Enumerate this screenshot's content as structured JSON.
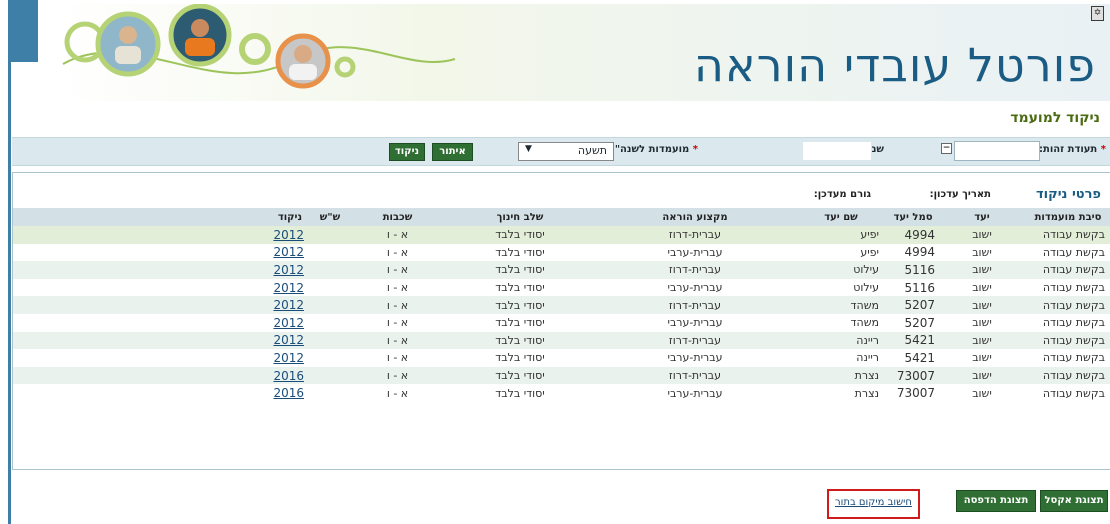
{
  "header": {
    "title": "פורטל עובדי הוראה",
    "corner_icon": "emblem-icon"
  },
  "page_subtitle": "ניקוד למועמד",
  "search": {
    "id_label": "תעודת זהות:",
    "required_mark": "*",
    "name_label": "שם:",
    "year_label": "מועמדות לשנה\"ל:",
    "year_value": "תשעה",
    "locate_button": "איתור",
    "score_button": "ניקוד"
  },
  "details": {
    "title": "פרטי ניקוד",
    "updated_label": "תאריך עדכון:",
    "updated_by_label": "גורם מעדכן:",
    "columns": [
      "סיבת מועמדות",
      "יעד",
      "סמל יעד",
      "שם יעד",
      "מקצוע הוראה",
      "שלב חינוך",
      "שכבות",
      "ש\"ש",
      "ניקוד"
    ],
    "rows": [
      [
        "בקשת עבודה",
        "ישוב",
        "4994",
        "יפיע",
        "עברית-דרוז",
        "יסודי בלבד",
        "א - ו",
        "",
        "2012"
      ],
      [
        "בקשת עבודה",
        "ישוב",
        "4994",
        "יפיע",
        "עברית-ערבי",
        "יסודי בלבד",
        "א - ו",
        "",
        "2012"
      ],
      [
        "בקשת עבודה",
        "ישוב",
        "5116",
        "עילוט",
        "עברית-דרוז",
        "יסודי בלבד",
        "א - ו",
        "",
        "2012"
      ],
      [
        "בקשת עבודה",
        "ישוב",
        "5116",
        "עילוט",
        "עברית-ערבי",
        "יסודי בלבד",
        "א - ו",
        "",
        "2012"
      ],
      [
        "בקשת עבודה",
        "ישוב",
        "5207",
        "משהד",
        "עברית-דרוז",
        "יסודי בלבד",
        "א - ו",
        "",
        "2012"
      ],
      [
        "בקשת עבודה",
        "ישוב",
        "5207",
        "משהד",
        "עברית-ערבי",
        "יסודי בלבד",
        "א - ו",
        "",
        "2012"
      ],
      [
        "בקשת עבודה",
        "ישוב",
        "5421",
        "ריינה",
        "עברית-דרוז",
        "יסודי בלבד",
        "א - ו",
        "",
        "2012"
      ],
      [
        "בקשת עבודה",
        "ישוב",
        "5421",
        "ריינה",
        "עברית-ערבי",
        "יסודי בלבד",
        "א - ו",
        "",
        "2012"
      ],
      [
        "בקשת עבודה",
        "ישוב",
        "73007",
        "נצרת",
        "עברית-דרוז",
        "יסודי בלבד",
        "א - ו",
        "",
        "2016"
      ],
      [
        "בקשת עבודה",
        "ישוב",
        "73007",
        "נצרת",
        "עברית-ערבי",
        "יסודי בלבד",
        "א - ו",
        "",
        "2016"
      ]
    ]
  },
  "footer": {
    "excel_button": "תצוגת אקסל",
    "print_button": "תצוגת הדפסה",
    "recalc_link": "חישוב מיקום בתור"
  },
  "colors": {
    "accent_blue": "#1a5c83",
    "button_green": "#2f6f33",
    "highlight_red": "#d11b1b"
  }
}
